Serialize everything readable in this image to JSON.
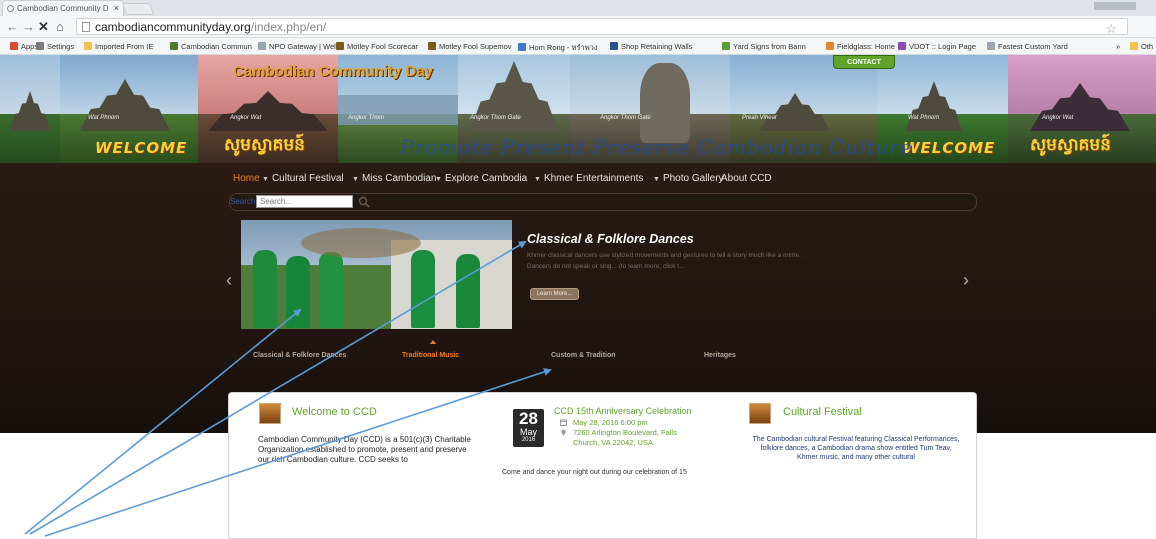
{
  "browser": {
    "tab_title": "Cambodian Community D",
    "tab_close": "×",
    "url_domain": "cambodiancommunityday.org",
    "url_path": "/index.php/en/",
    "bookmarks": [
      {
        "label": "Apps",
        "color": "#d94a38"
      },
      {
        "label": "Settings",
        "color": "#7a7a7a"
      },
      {
        "label": "Imported From IE",
        "color": "#f0c24b"
      },
      {
        "label": "Cambodian Commun",
        "color": "#4c7a2e"
      },
      {
        "label": "NPO Gateway | Welco",
        "color": "#9aa5b1"
      },
      {
        "label": "Motley Fool Scorecar",
        "color": "#7a5b1e"
      },
      {
        "label": "Motley Fool Supemov",
        "color": "#7a5b1e"
      },
      {
        "label": "Hom Rong - หรำพวง",
        "color": "#3d7cc9"
      },
      {
        "label": "Shop Retaining Walls",
        "color": "#2b4f8c"
      },
      {
        "label": "Yard Signs from Bann",
        "color": "#5a9c2f"
      },
      {
        "label": "Fieldglass: Home",
        "color": "#e2872c"
      },
      {
        "label": "VDOT :: Login Page",
        "color": "#8a4fb5"
      },
      {
        "label": "Fastest Custom Yard",
        "color": "#9aa5b1"
      },
      {
        "label": "»",
        "color": "#ffffff"
      },
      {
        "label": "Oth",
        "color": "#f0c24b"
      }
    ]
  },
  "header": {
    "site_title": "Cambodian Community Day",
    "tagline": "Promote Present Preserve Cambodian Culture",
    "contact_label": "CONTACT",
    "welcome_text": "WELCOME",
    "khmer_welcome": "សូមស្វាគមន៍",
    "captions": [
      "Wat Phnom",
      "Angkor Wat",
      "Angkor Thom",
      "Angkor Thom Gate",
      "Angkor Thom Gate",
      "Preah Vihear",
      "Wat Phnom",
      "Angkor Wat"
    ]
  },
  "nav": {
    "items": [
      {
        "label": "Home",
        "caret": false
      },
      {
        "label": "Cultural Festival",
        "caret": true
      },
      {
        "label": "Miss Cambodian",
        "caret": true
      },
      {
        "label": "Explore Cambodia",
        "caret": true
      },
      {
        "label": "Khmer Entertainments",
        "caret": true
      },
      {
        "label": "Photo Gallery",
        "caret": true
      },
      {
        "label": "About CCD",
        "caret": false
      }
    ]
  },
  "search": {
    "label": "Search",
    "placeholder": "Search..."
  },
  "slider": {
    "title": "Classical & Folklore Dances",
    "description": "Khmer classical dancers use stylized movements and gestures to tell a story much like a mime. Dancers do not speak or sing... (to learn more, click t...",
    "button_label": "Learn More...",
    "prev": "‹",
    "next": "›",
    "tabs": [
      "Classical & Folklore Dances",
      "Traditional Music",
      "Custom & Tradition",
      "Heritages"
    ],
    "active_tab": 1
  },
  "content": {
    "welcome": {
      "title": "Welcome to CCD",
      "text": "Cambodian Community Day (CCD) is a 501(c)(3) Charitable Organization established to promote, present and preserve our rich Cambodian culture. CCD seeks to"
    },
    "event": {
      "day": "28",
      "month": "May",
      "year": "2016",
      "title": "CCD 15th Anniversary Celebration",
      "datetime": "May 28, 2016 6:00 pm",
      "address_1": "7260 Arlington Boulevard, Falls",
      "address_2": "Church, VA 22042, USA",
      "text": "Come and dance your night out during our celebration of 15"
    },
    "festival": {
      "title": "Cultural Festival",
      "text": "The Cambodian cultural Festival featuring Classical Performances, folklore dances, a Cambodian drama show entitled Tum Teav, Khmer music, and many other cultural"
    }
  },
  "colors": {
    "accent_orange": "#f0801c",
    "green": "#5fa329",
    "dark_bg": "#1f1410",
    "annotation_blue": "#5b9bd5"
  }
}
